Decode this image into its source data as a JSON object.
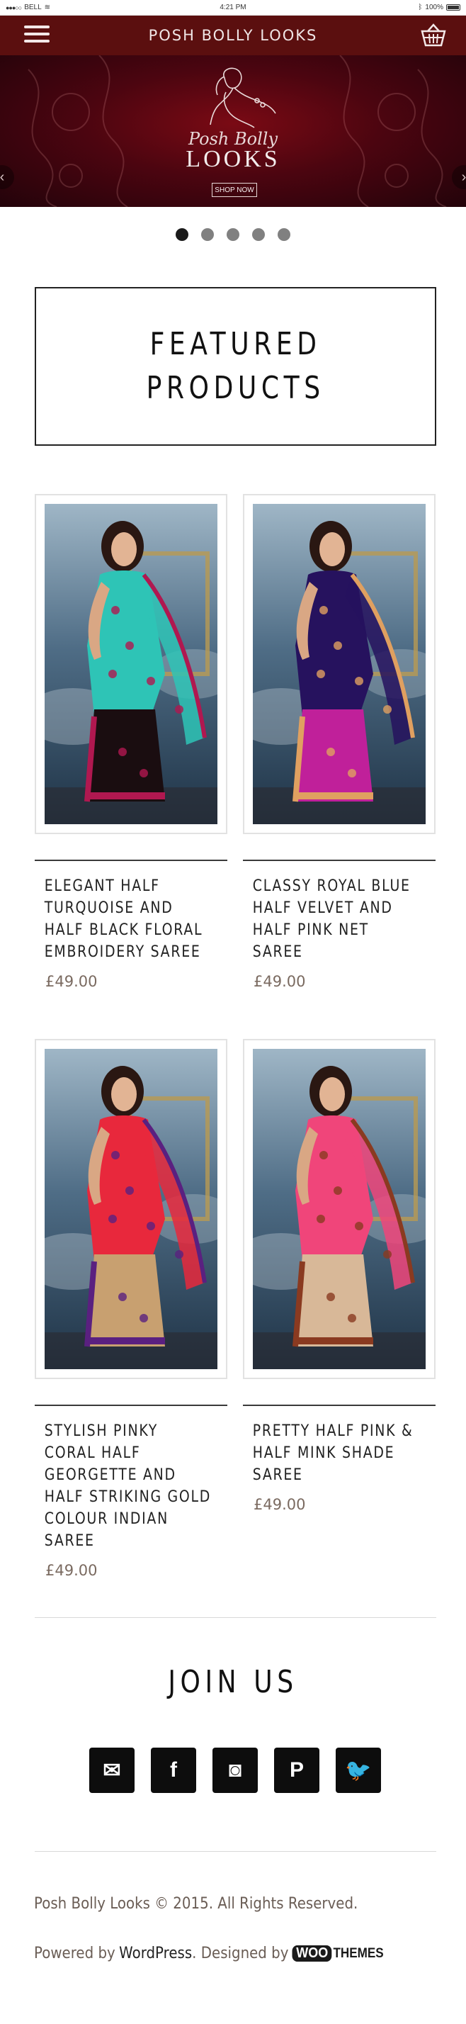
{
  "status_bar": {
    "carrier": "BELL",
    "time": "4:21 PM",
    "battery": "100%"
  },
  "header": {
    "title": "POSH BOLLY LOOKS",
    "menu_icon": "hamburger-menu-icon",
    "cart_icon": "basket-icon"
  },
  "banner": {
    "script_text": "Posh Bolly",
    "logo_text": "LOOKS",
    "button_label": "SHOP NOW",
    "prev_arrow": "‹",
    "next_arrow": "›"
  },
  "slider": {
    "slide_count": 5,
    "active_index": 0
  },
  "featured": {
    "line1": "FEATURED",
    "line2": "PRODUCTS"
  },
  "products": [
    {
      "name": "Elegant Half Turquoise and Half Black Floral Embroidery Saree",
      "price": "£49.00",
      "colors": {
        "top": "#2ec4b6",
        "bottom": "#1a0d10",
        "border": "#b01850"
      }
    },
    {
      "name": "Classy Royal Blue Half Velvet and Half Pink Net Saree",
      "price": "£49.00",
      "colors": {
        "top": "#26125e",
        "bottom": "#c0209a",
        "border": "#e0a060"
      }
    },
    {
      "name": "Stylish Pinky Coral Half Georgette and Half Striking Gold Colour Indian Saree",
      "price": "£49.00",
      "colors": {
        "top": "#e8283c",
        "bottom": "#c8a070",
        "border": "#5a2080"
      }
    },
    {
      "name": "Pretty Half Pink & Half Mink Shade Saree",
      "price": "£49.00",
      "colors": {
        "top": "#f0457a",
        "bottom": "#d8b898",
        "border": "#8a3a20"
      }
    }
  ],
  "join": {
    "heading": "JOIN US",
    "social": [
      {
        "name": "email-icon",
        "glyph": "✉"
      },
      {
        "name": "facebook-icon",
        "glyph": "f"
      },
      {
        "name": "instagram-icon",
        "glyph": "◙"
      },
      {
        "name": "pinterest-icon",
        "glyph": "P"
      },
      {
        "name": "twitter-icon",
        "glyph": "🐦"
      }
    ]
  },
  "footer": {
    "copyright": "Posh Bolly Looks © 2015. All Rights Reserved.",
    "powered_prefix": "Powered by",
    "powered_link": "WordPress",
    "designed_prefix": ". Designed by",
    "woo_part": "WOO",
    "themes_part": "THEMES"
  },
  "colors": {
    "header_bg": "#5b0f0f",
    "banner_bg": "#4c0510",
    "dot_active": "#1a1a1a",
    "dot_inactive": "#808080"
  }
}
